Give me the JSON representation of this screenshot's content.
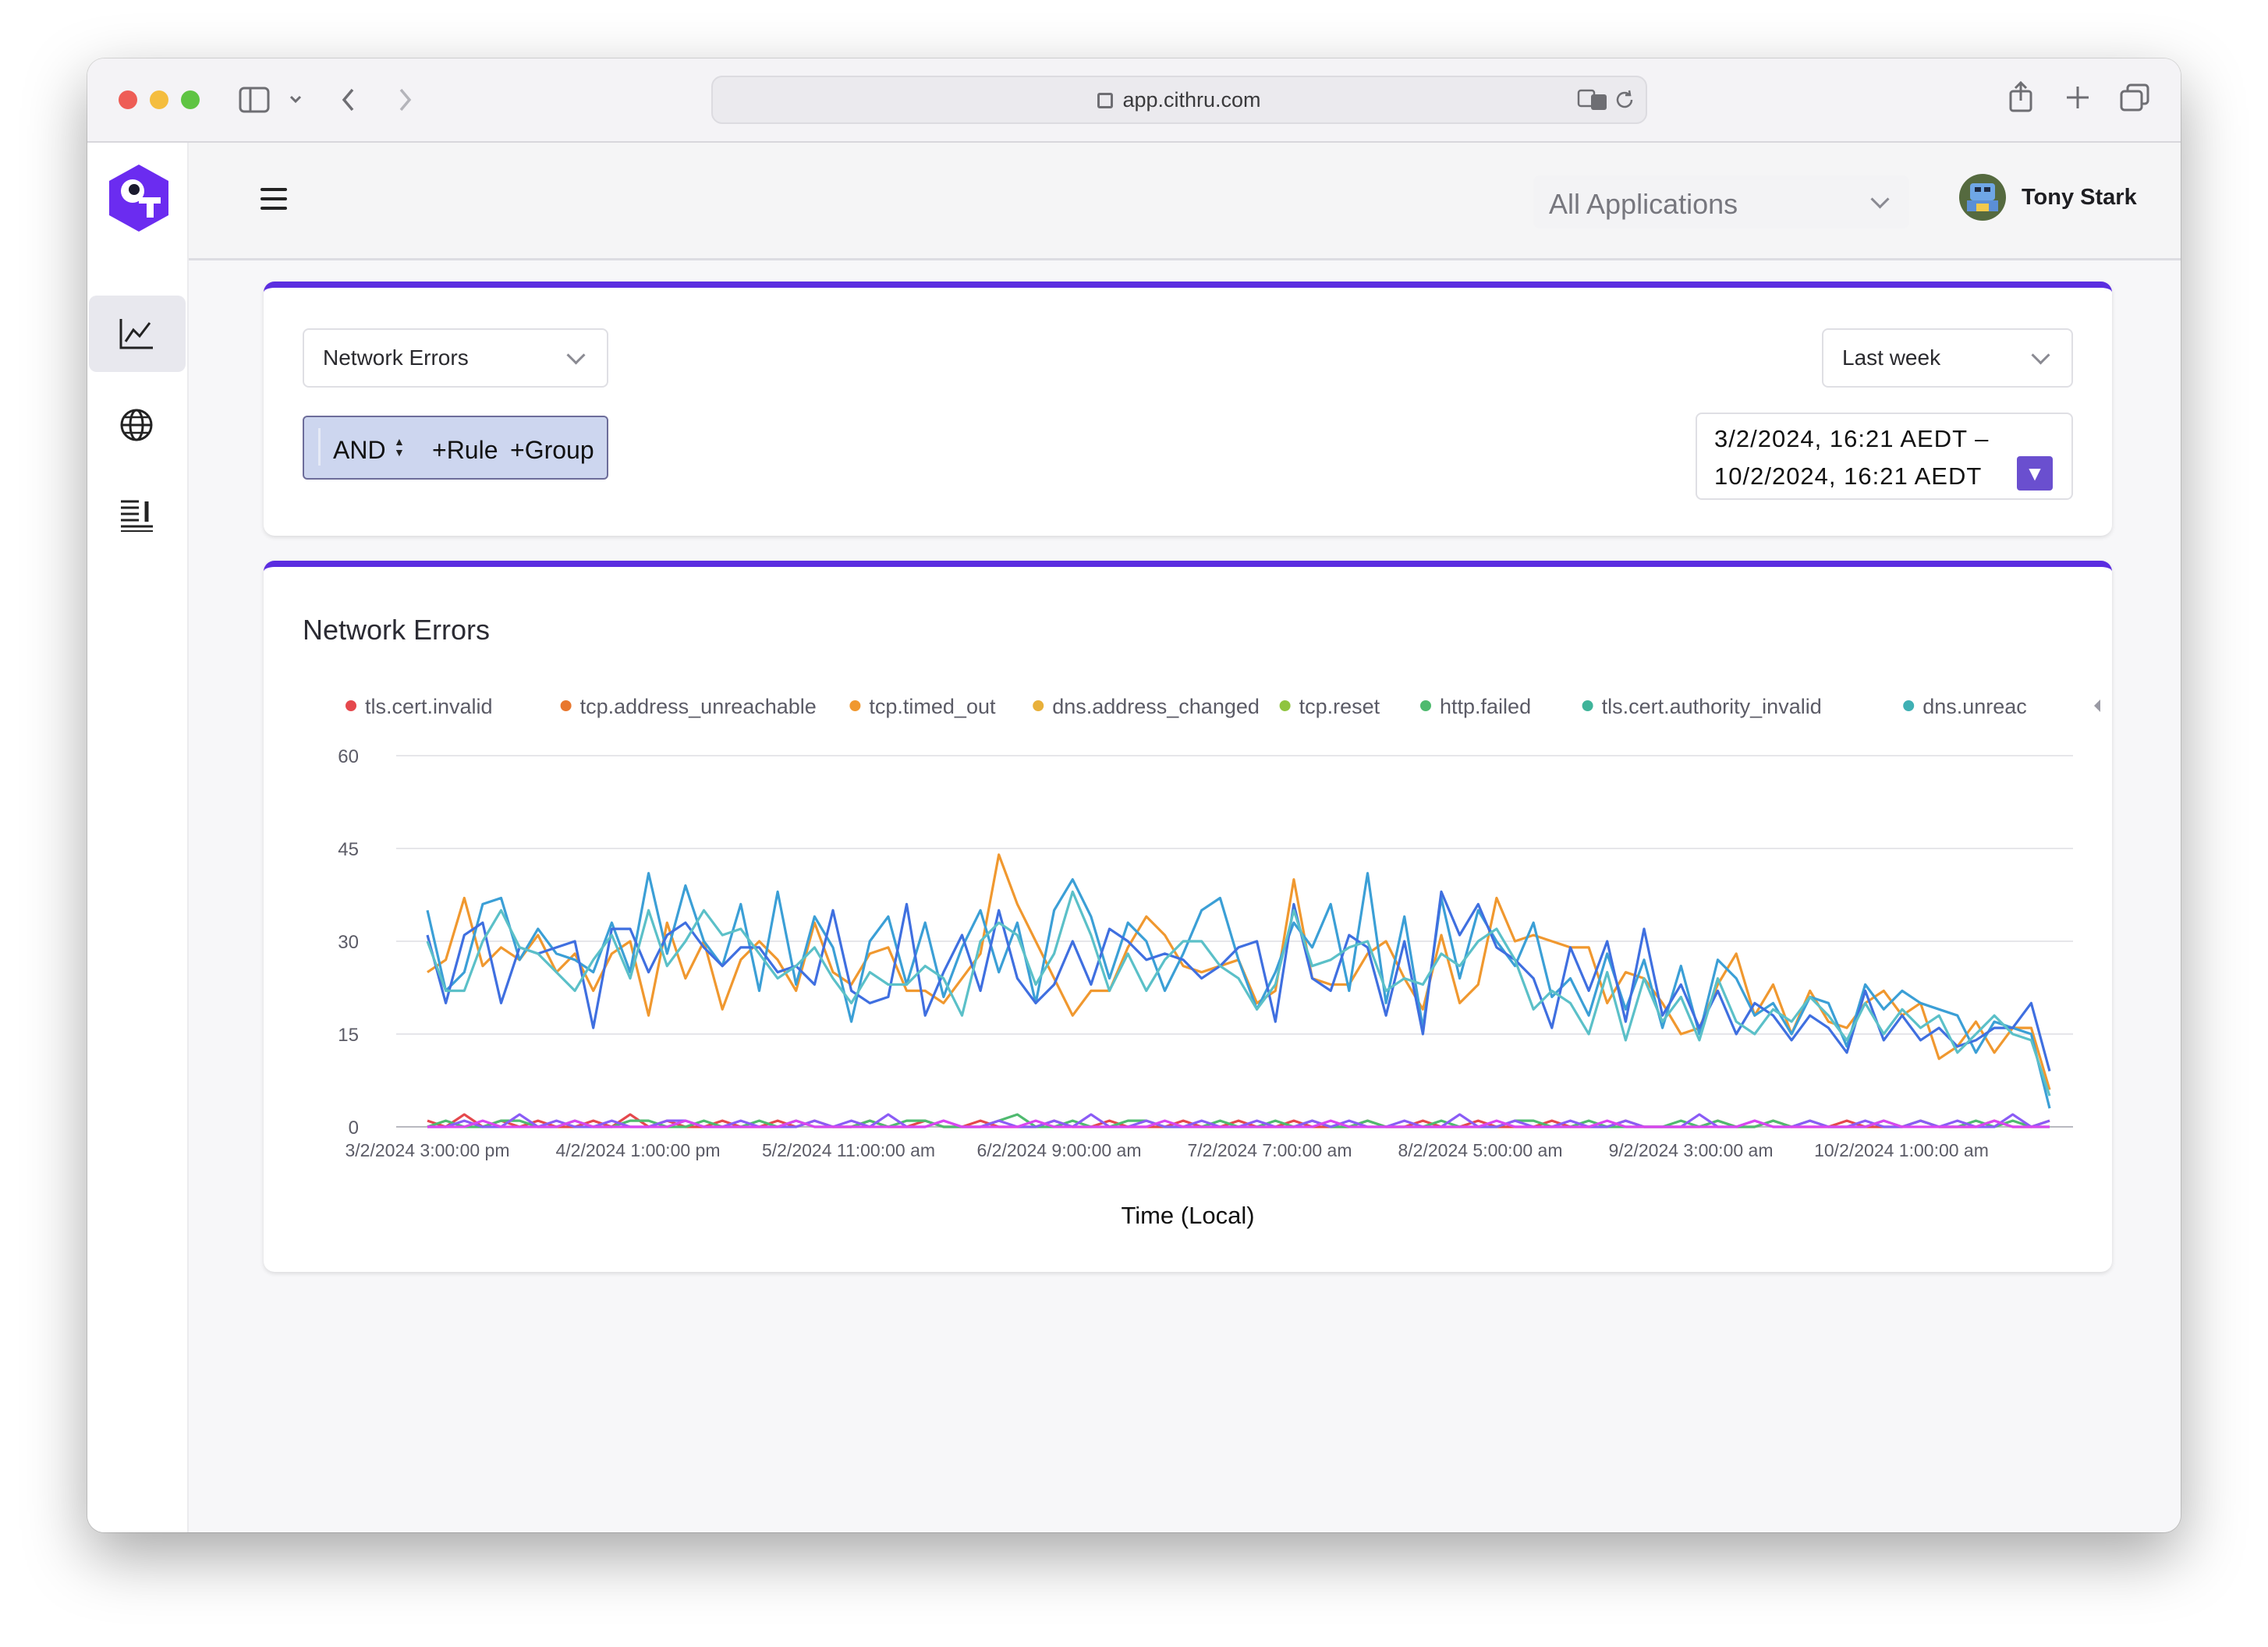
{
  "browser": {
    "url": "app.cithru.com"
  },
  "header": {
    "app_select": "All Applications",
    "user_name": "Tony Stark"
  },
  "filters": {
    "metric_select": "Network Errors",
    "time_range_select": "Last week",
    "query": {
      "operator": "AND",
      "add_rule": "+Rule",
      "add_group": "+Group"
    },
    "date_range": {
      "start": "3/2/2024, 16:21 AEDT  –",
      "end": "10/2/2024, 16:21 AEDT",
      "button": "▼"
    }
  },
  "colors": {
    "accent": "#5b2de0",
    "date_button": "#6a4fcf"
  },
  "chart_data": {
    "type": "line",
    "title": "Network Errors",
    "xlabel": "Time (Local)",
    "ylabel": "",
    "ylim": [
      0,
      60
    ],
    "yticks": [
      "0",
      "15",
      "30",
      "45",
      "60"
    ],
    "xticks": [
      "3/2/2024 3:00:00 pm",
      "4/2/2024 1:00:00 pm",
      "5/2/2024 11:00:00 am",
      "6/2/2024 9:00:00 am",
      "7/2/2024 7:00:00 am",
      "8/2/2024 5:00:00 am",
      "9/2/2024 3:00:00 am",
      "10/2/2024 1:00:00 am"
    ],
    "legend": [
      "tls.cert.invalid",
      "tcp.address_unreachable",
      "tcp.timed_out",
      "dns.address_changed",
      "tcp.reset",
      "http.failed",
      "tls.cert.authority_invalid",
      "dns.unreac"
    ],
    "legend_colors": [
      "#e5484d",
      "#e8772e",
      "#f0982f",
      "#e8b03a",
      "#8fc43f",
      "#4fba6f",
      "#3fb49a",
      "#3fb0b4"
    ],
    "legend_position": "top",
    "grid": true,
    "series": [
      {
        "color": "#f0982f",
        "values": [
          25,
          27,
          37,
          26,
          29,
          27,
          31,
          25,
          28,
          22,
          28,
          30,
          18,
          33,
          24,
          30,
          19,
          27,
          30,
          27,
          22,
          33,
          25,
          23,
          28,
          29,
          22,
          22,
          20,
          24,
          28,
          44,
          36,
          30,
          24,
          18,
          22,
          22,
          29,
          34,
          31,
          26,
          25,
          26,
          27,
          20,
          22,
          40,
          24,
          23,
          23,
          28,
          30,
          24,
          19,
          31,
          20,
          23,
          37,
          30,
          31,
          30,
          29,
          29,
          20,
          25,
          24,
          20,
          15,
          16,
          23,
          28,
          18,
          23,
          15,
          22,
          17,
          16,
          20,
          22,
          18,
          20,
          11,
          13,
          17,
          12,
          16,
          16,
          6
        ]
      },
      {
        "color": "#3b9fd6",
        "values": [
          35,
          22,
          25,
          36,
          37,
          27,
          32,
          28,
          27,
          25,
          33,
          25,
          41,
          28,
          39,
          30,
          26,
          36,
          22,
          38,
          23,
          34,
          29,
          17,
          30,
          34,
          23,
          33,
          21,
          29,
          35,
          25,
          33,
          20,
          35,
          40,
          34,
          24,
          33,
          30,
          22,
          28,
          35,
          37,
          27,
          19,
          25,
          33,
          29,
          36,
          22,
          41,
          20,
          34,
          16,
          37,
          24,
          35,
          30,
          26,
          33,
          21,
          24,
          18,
          28,
          19,
          27,
          16,
          26,
          15,
          27,
          24,
          18,
          20,
          15,
          21,
          20,
          13,
          23,
          19,
          22,
          20,
          19,
          18,
          12,
          17,
          16,
          15,
          3
        ]
      },
      {
        "color": "#3f6fe0",
        "values": [
          31,
          20,
          31,
          33,
          20,
          29,
          28,
          29,
          30,
          16,
          32,
          32,
          25,
          31,
          33,
          29,
          26,
          29,
          29,
          25,
          26,
          23,
          35,
          22,
          20,
          21,
          36,
          18,
          25,
          31,
          22,
          35,
          24,
          20,
          23,
          30,
          23,
          32,
          30,
          27,
          28,
          27,
          24,
          26,
          29,
          30,
          17,
          36,
          24,
          22,
          31,
          29,
          18,
          30,
          15,
          38,
          31,
          36,
          29,
          27,
          24,
          16,
          29,
          22,
          30,
          17,
          32,
          18,
          23,
          16,
          22,
          15,
          20,
          18,
          14,
          18,
          16,
          12,
          22,
          14,
          18,
          14,
          16,
          13,
          14,
          16,
          16,
          20,
          9
        ]
      },
      {
        "color": "#5bc0c8",
        "values": [
          30,
          22,
          22,
          30,
          35,
          29,
          28,
          25,
          22,
          27,
          31,
          24,
          35,
          26,
          30,
          35,
          31,
          32,
          28,
          24,
          26,
          29,
          24,
          20,
          25,
          23,
          23,
          26,
          24,
          18,
          30,
          33,
          31,
          23,
          28,
          38,
          31,
          22,
          28,
          22,
          27,
          30,
          30,
          26,
          24,
          19,
          23,
          35,
          26,
          27,
          29,
          30,
          22,
          24,
          23,
          28,
          26,
          30,
          32,
          27,
          19,
          22,
          20,
          15,
          25,
          14,
          24,
          17,
          21,
          14,
          24,
          17,
          15,
          19,
          17,
          21,
          18,
          14,
          20,
          15,
          19,
          16,
          18,
          12,
          15,
          18,
          15,
          14,
          5
        ]
      },
      {
        "color": "#e5484d",
        "values": [
          1,
          0,
          2,
          0,
          1,
          0,
          1,
          0,
          0,
          1,
          0,
          2,
          0,
          1,
          0,
          0,
          1,
          0,
          0,
          1,
          0,
          1,
          0,
          0,
          1,
          0,
          0,
          1,
          0,
          0,
          1,
          0,
          0,
          0,
          1,
          0,
          0,
          1,
          0,
          0,
          0,
          1,
          0,
          0,
          1,
          0,
          0,
          1,
          0,
          0,
          0,
          1,
          0,
          0,
          1,
          0,
          0,
          1,
          0,
          0,
          0,
          1,
          0,
          0,
          0,
          1,
          0,
          0,
          0,
          0,
          1,
          0,
          0,
          1,
          0,
          0,
          0,
          1,
          0,
          0,
          0,
          1,
          0,
          0,
          0,
          1,
          0,
          0,
          1
        ]
      },
      {
        "color": "#4fba6f",
        "values": [
          0,
          1,
          0,
          0,
          1,
          1,
          0,
          0,
          1,
          0,
          0,
          1,
          1,
          0,
          0,
          1,
          0,
          0,
          1,
          0,
          1,
          0,
          0,
          0,
          1,
          0,
          1,
          1,
          0,
          0,
          0,
          1,
          2,
          0,
          0,
          1,
          0,
          0,
          1,
          1,
          0,
          0,
          0,
          1,
          0,
          0,
          1,
          0,
          1,
          0,
          0,
          1,
          0,
          0,
          0,
          1,
          0,
          0,
          0,
          1,
          1,
          0,
          0,
          1,
          0,
          0,
          0,
          0,
          1,
          0,
          1,
          0,
          0,
          1,
          0,
          1,
          0,
          0,
          0,
          1,
          0,
          1,
          0,
          0,
          1,
          0,
          1,
          0,
          0
        ]
      },
      {
        "color": "#8b5cf6",
        "values": [
          0,
          0,
          1,
          0,
          0,
          2,
          0,
          1,
          0,
          0,
          1,
          0,
          0,
          1,
          1,
          0,
          0,
          1,
          0,
          0,
          0,
          1,
          0,
          1,
          0,
          2,
          0,
          0,
          1,
          0,
          0,
          1,
          0,
          0,
          1,
          0,
          2,
          0,
          0,
          1,
          0,
          0,
          1,
          0,
          0,
          1,
          0,
          0,
          1,
          0,
          1,
          0,
          0,
          1,
          0,
          0,
          2,
          0,
          0,
          1,
          0,
          0,
          1,
          0,
          0,
          1,
          0,
          0,
          0,
          2,
          0,
          0,
          1,
          0,
          0,
          1,
          0,
          0,
          1,
          0,
          0,
          1,
          0,
          1,
          0,
          0,
          2,
          0,
          1
        ]
      },
      {
        "color": "#d946ef",
        "values": [
          0,
          0,
          0,
          1,
          0,
          0,
          0,
          0,
          1,
          0,
          0,
          0,
          0,
          0,
          1,
          0,
          0,
          0,
          0,
          0,
          1,
          0,
          0,
          0,
          0,
          0,
          0,
          0,
          1,
          0,
          0,
          0,
          0,
          1,
          0,
          0,
          0,
          0,
          0,
          0,
          1,
          0,
          0,
          0,
          0,
          0,
          0,
          0,
          0,
          1,
          0,
          0,
          0,
          0,
          0,
          0,
          0,
          0,
          1,
          0,
          0,
          0,
          0,
          0,
          1,
          0,
          0,
          0,
          0,
          0,
          0,
          0,
          1,
          0,
          0,
          0,
          0,
          0,
          0,
          1,
          0,
          0,
          0,
          0,
          0,
          1,
          0,
          0,
          0
        ]
      }
    ]
  }
}
